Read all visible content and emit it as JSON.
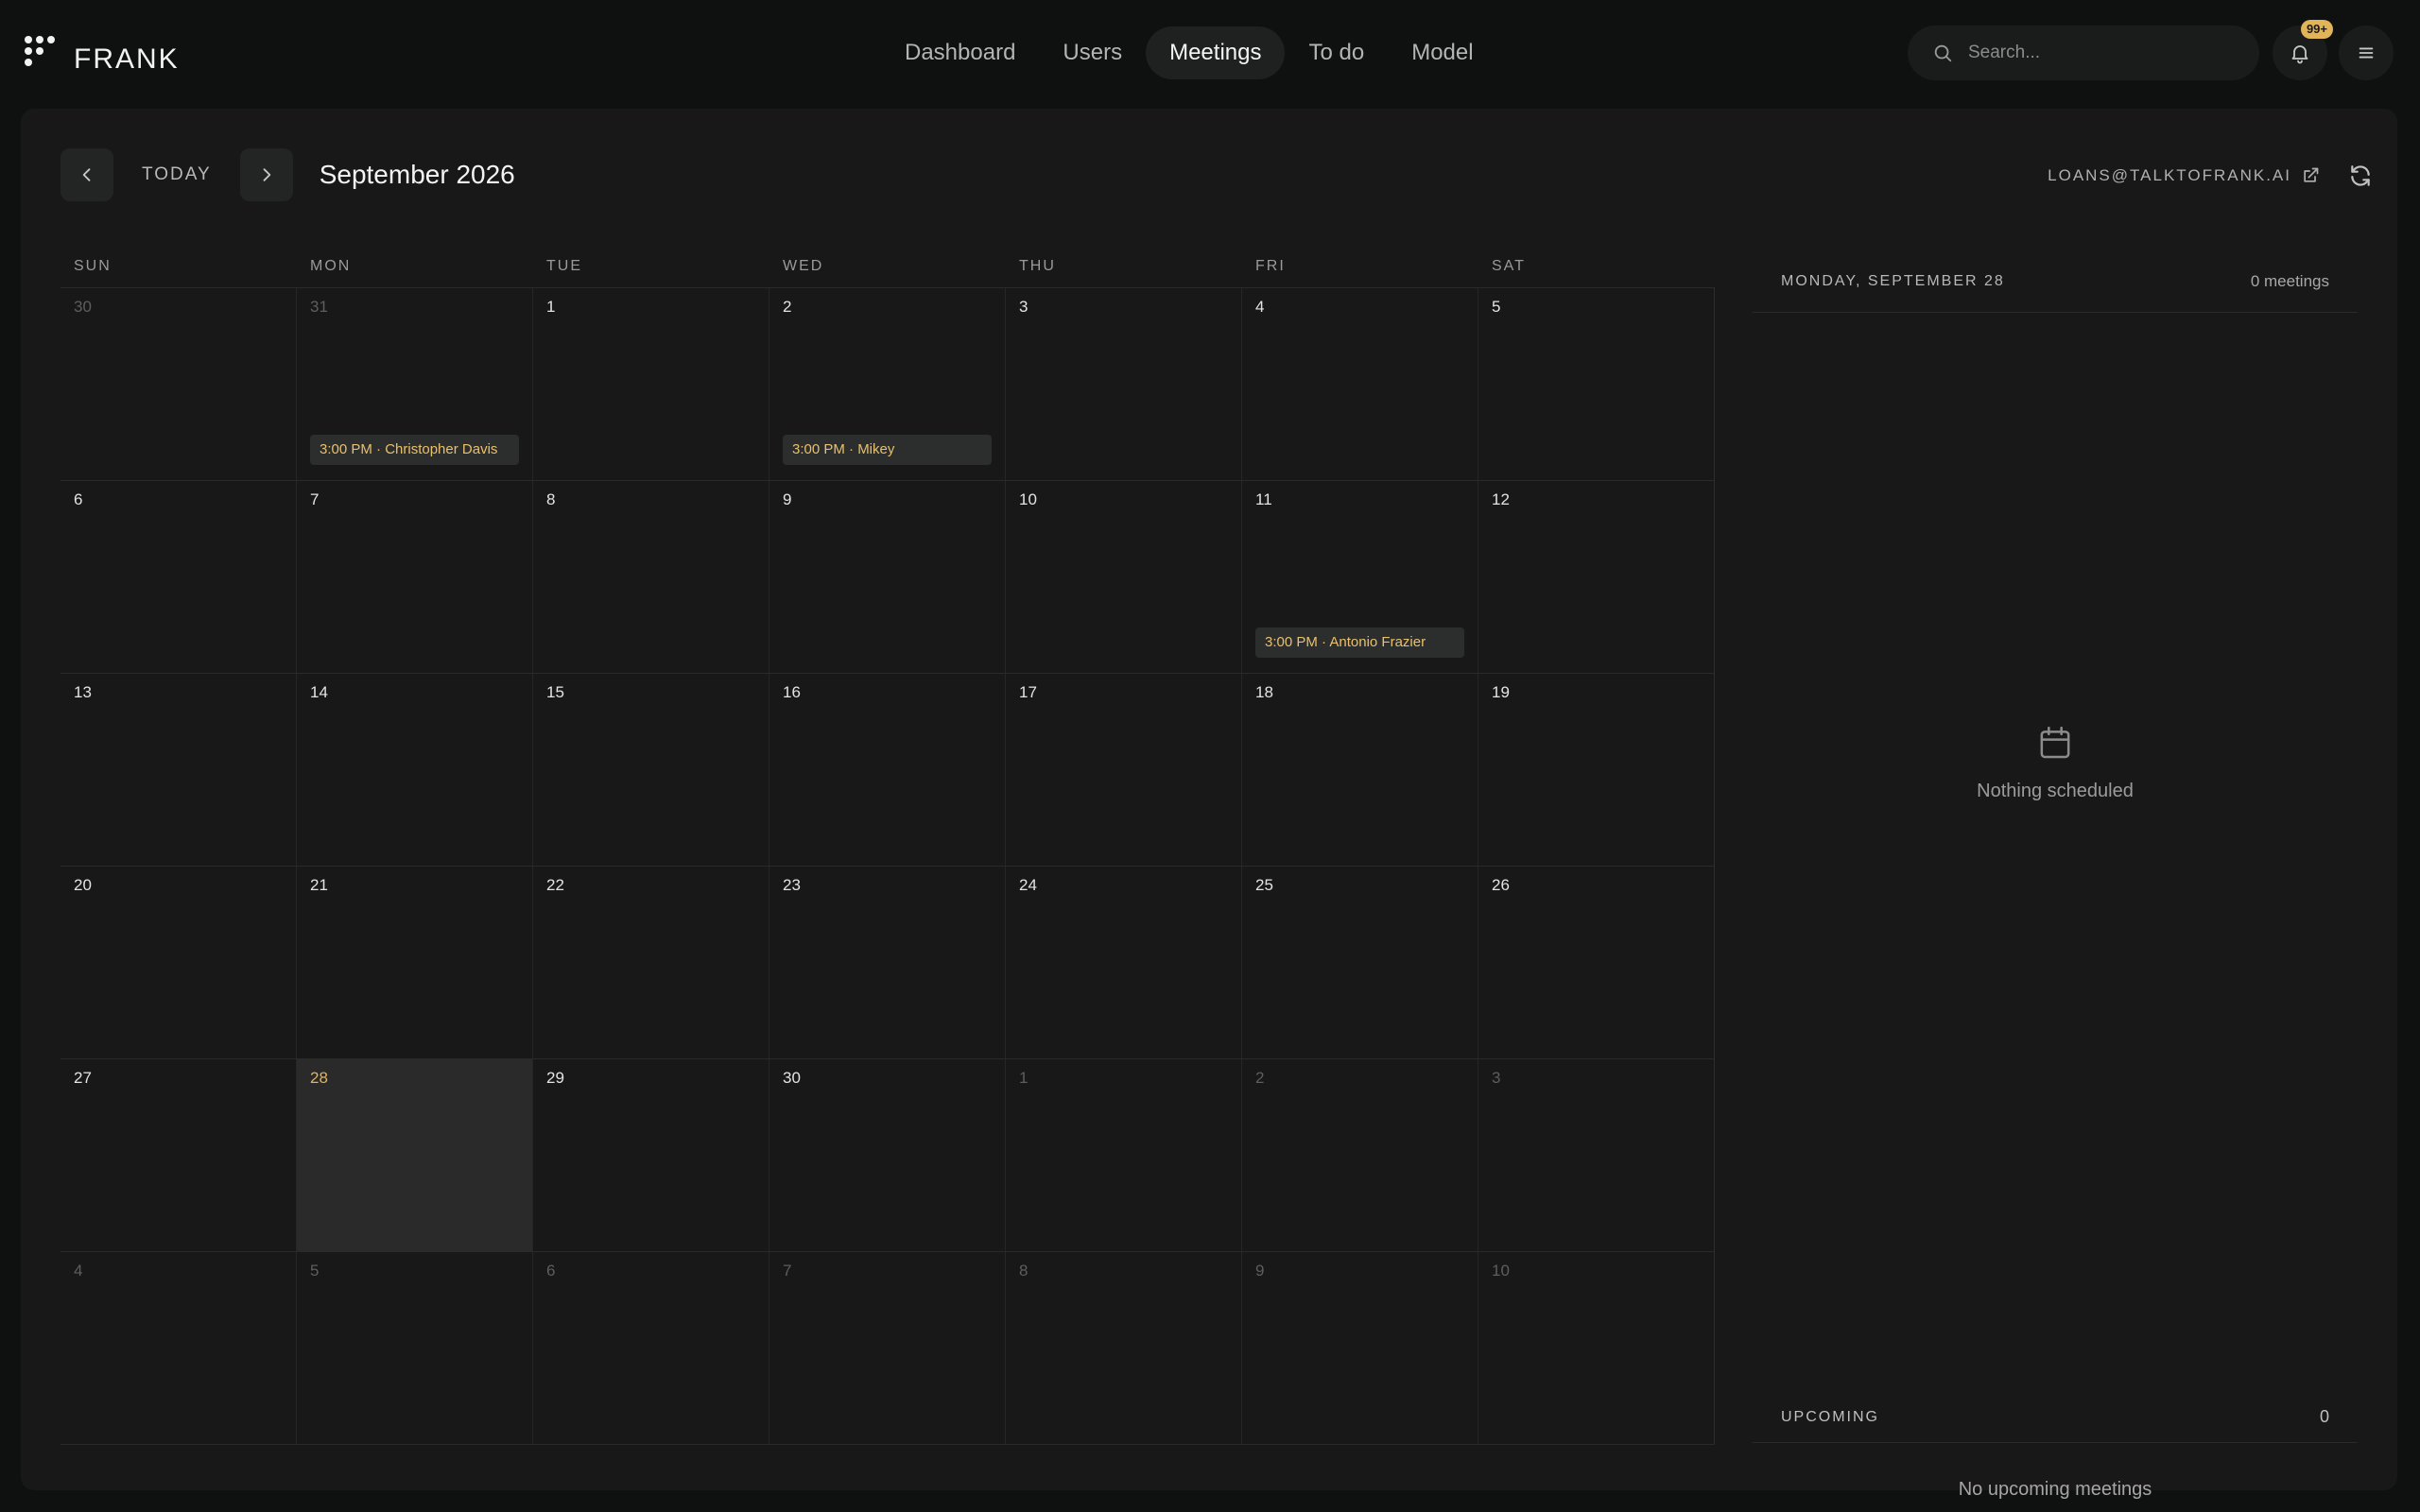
{
  "app": {
    "name": "FRANK"
  },
  "nav": [
    "Dashboard",
    "Users",
    "Meetings",
    "To do",
    "Model"
  ],
  "search": {
    "placeholder": "Search..."
  },
  "notifications": {
    "badge": "99+"
  },
  "calendar": {
    "today_label": "TODAY",
    "month_title": "September 2026",
    "email": "LOANS@TALKTOFRANK.AI",
    "days_of_week": [
      "SUN",
      "MON",
      "TUE",
      "WED",
      "THU",
      "FRI",
      "SAT"
    ],
    "weeks": [
      [
        {
          "n": "30",
          "muted": true
        },
        {
          "n": "31",
          "muted": true,
          "event": "3:00 PM · Christopher Davis"
        },
        {
          "n": "1"
        },
        {
          "n": "2",
          "event": "3:00 PM · Mikey"
        },
        {
          "n": "3"
        },
        {
          "n": "4"
        },
        {
          "n": "5"
        }
      ],
      [
        {
          "n": "6"
        },
        {
          "n": "7"
        },
        {
          "n": "8"
        },
        {
          "n": "9"
        },
        {
          "n": "10"
        },
        {
          "n": "11",
          "event": "3:00 PM · Antonio Frazier"
        },
        {
          "n": "12"
        }
      ],
      [
        {
          "n": "13"
        },
        {
          "n": "14"
        },
        {
          "n": "15"
        },
        {
          "n": "16"
        },
        {
          "n": "17"
        },
        {
          "n": "18"
        },
        {
          "n": "19"
        }
      ],
      [
        {
          "n": "20"
        },
        {
          "n": "21"
        },
        {
          "n": "22"
        },
        {
          "n": "23"
        },
        {
          "n": "24"
        },
        {
          "n": "25"
        },
        {
          "n": "26"
        }
      ],
      [
        {
          "n": "27"
        },
        {
          "n": "28",
          "selected": true
        },
        {
          "n": "29"
        },
        {
          "n": "30"
        },
        {
          "n": "1",
          "muted": true
        },
        {
          "n": "2",
          "muted": true
        },
        {
          "n": "3",
          "muted": true
        }
      ],
      [
        {
          "n": "4",
          "muted": true
        },
        {
          "n": "5",
          "muted": true
        },
        {
          "n": "6",
          "muted": true
        },
        {
          "n": "7",
          "muted": true
        },
        {
          "n": "8",
          "muted": true
        },
        {
          "n": "9",
          "muted": true
        },
        {
          "n": "10",
          "muted": true
        }
      ]
    ]
  },
  "sidebar": {
    "date": "MONDAY, SEPTEMBER 28",
    "count": "0 meetings",
    "empty_text": "Nothing scheduled",
    "upcoming_label": "UPCOMING",
    "upcoming_count": "0",
    "no_upcoming": "No upcoming meetings"
  },
  "colors": {
    "accent": "#e2b45a",
    "background": "#0f1010",
    "panel": "#181818"
  }
}
